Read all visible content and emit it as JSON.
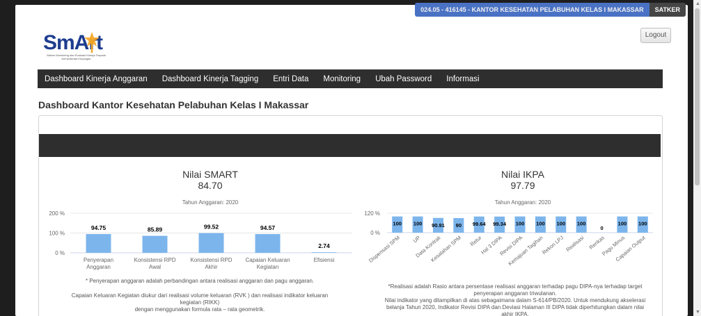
{
  "header": {
    "satker_name": "024.05 - 416145 - KANTOR KESEHATAN PELABUHAN KELAS I MAKASSAR",
    "satker_label": "SATKER",
    "logout_label": "Logout",
    "logo_text": "SmArt",
    "logo_sub1": "Sistem Monitoring dan Evaluasi Kinerja Terpadu",
    "logo_sub2": "Kementerian Keuangan"
  },
  "nav": {
    "items": [
      "Dashboard Kinerja Anggaran",
      "Dashboard Kinerja Tagging",
      "Entri Data",
      "Monitoring",
      "Ubah Password",
      "Informasi"
    ]
  },
  "page": {
    "title": "Dashboard Kantor Kesehatan Pelabuhan Kelas I Makassar"
  },
  "smart": {
    "title": "Nilai SMART",
    "value": "84.70",
    "year_label": "Tahun Anggaran: 2020",
    "note1": "* Penyerapan anggaran adalah perbandingan antara realisasi anggaran dan pagu anggaran.",
    "note2": "Capaian Keluaran Kegiatan diukur dari realisasi volume keluaran (RVK ) dan realisasi indikator keluaran kegiatan (RIKK)",
    "note3": "dengan menggunakan formula rata – rata geometrik."
  },
  "ikpa": {
    "title": "Nilai IKPA",
    "value": "97.79",
    "year_label": "Tahun Anggaran: 2020",
    "note1": "*Realisasi adalah Rasio antara persentase realisasi anggaran terhadap pagu DIPA-nya terhadap target penyerapan anggaran triwulanan.",
    "note2": "Nilai indikator yang ditampilkan di atas sebagaimana dalam S-614/PB/2020. Untuk mendukung akselerasi belanja Tahun 2020, Indikator Revisi DIPA dan Deviasi Halaman III DIPA tidak diperhitungkan dalam nilai akhir IKPA."
  },
  "chart_data": [
    {
      "type": "bar",
      "categories": [
        "Penyerapan Anggaran",
        "Konsistensi RPD Awal",
        "Konsistensi RPD Akhir",
        "Capaian Keluaran Kegiatan",
        "Efisiensi"
      ],
      "values": [
        94.75,
        85.89,
        99.52,
        94.57,
        2.74
      ],
      "data_labels": [
        "94.75",
        "85.89",
        "99.52",
        "94.57",
        "2.74"
      ],
      "ylim": [
        0,
        200
      ],
      "y_ticks": [
        "0 %",
        "100 %",
        "200 %"
      ],
      "color": "#7cb5ec"
    },
    {
      "type": "bar",
      "categories": [
        "Dispensasi SPM",
        "UP",
        "Data Kontrak",
        "Kesalahan SPM",
        "Retur",
        "Hal 3 DIPA",
        "Revisi DIPA",
        "Kemajuan Tagihan",
        "Rekon LPJ",
        "Realisasi",
        "Renkas",
        "Pagu Minus",
        "Capaian Output"
      ],
      "values": [
        100,
        100,
        90.91,
        90,
        99.64,
        99.34,
        100,
        100,
        100,
        100,
        0,
        100,
        100
      ],
      "data_labels": [
        "100",
        "100",
        "90.91",
        "90",
        "99.64",
        "99.34",
        "100",
        "100",
        "100",
        "100",
        "0",
        "100",
        "100"
      ],
      "ylim": [
        0,
        120
      ],
      "y_ticks": [
        "0 %",
        "120 %"
      ],
      "color": "#7cb5ec"
    }
  ],
  "colors": {
    "navbar": "#2e2e2e",
    "satker_blue": "#4a72c4",
    "bar": "#7cb5ec",
    "logo_blue": "#1e3d8f",
    "logo_orange": "#f5a623"
  }
}
